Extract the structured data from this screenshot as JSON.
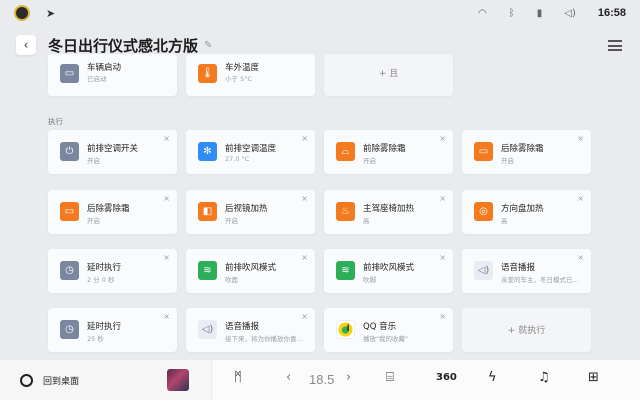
{
  "status_bar": {
    "time": "16:58",
    "icons": [
      "app-logo-icon",
      "navigation-arrow-icon",
      "wifi-icon",
      "bluetooth-icon",
      "signal-icon",
      "volume-icon"
    ]
  },
  "header": {
    "back_icon": "back-icon",
    "title": "冬日出行仪式感北方版",
    "edit_icon": "edit-icon",
    "filter_icon": "filter-icon"
  },
  "conditions": [
    {
      "title": "车辆启动",
      "subtitle": "已启动",
      "icon": "car-icon",
      "color": "#7b86a0"
    },
    {
      "title": "车外温度",
      "subtitle": "小于 5°C",
      "icon": "thermometer-icon",
      "color": "#f47a1f"
    }
  ],
  "condition_add": {
    "label": "+ 且"
  },
  "section_label": "执行",
  "actions": [
    {
      "title": "前排空调开关",
      "subtitle": "开启",
      "icon": "power-icon",
      "color": "#7b86a0"
    },
    {
      "title": "前排空调温度",
      "subtitle": "27.0 °C",
      "icon": "ac-temperature-icon",
      "color": "#2f8df4"
    },
    {
      "title": "前除雾除霜",
      "subtitle": "开启",
      "icon": "front-defrost-icon",
      "color": "#f47a1f"
    },
    {
      "title": "后除雾除霜",
      "subtitle": "开启",
      "icon": "rear-defrost-icon",
      "color": "#f47a1f"
    },
    {
      "title": "后除雾除霜",
      "subtitle": "开启",
      "icon": "rear-defrost-icon",
      "color": "#f47a1f"
    },
    {
      "title": "后视镜加热",
      "subtitle": "开启",
      "icon": "mirror-heat-icon",
      "color": "#f47a1f"
    },
    {
      "title": "主驾座椅加热",
      "subtitle": "高",
      "icon": "seat-heat-icon",
      "color": "#f47a1f"
    },
    {
      "title": "方向盘加热",
      "subtitle": "高",
      "icon": "steering-heat-icon",
      "color": "#f47a1f"
    },
    {
      "title": "延时执行",
      "subtitle": "2 分 0 秒",
      "icon": "delay-icon",
      "color": "#7b86a0"
    },
    {
      "title": "前排吹风模式",
      "subtitle": "吹面",
      "icon": "airflow-icon",
      "color": "#2fae5a"
    },
    {
      "title": "前排吹风模式",
      "subtitle": "吹脚",
      "icon": "airflow-icon",
      "color": "#2fae5a"
    },
    {
      "title": "语音播报",
      "subtitle": "亲爱的车主，冬日模式已…",
      "icon": "voice-broadcast-icon",
      "color": "#e9edf3"
    },
    {
      "title": "延时执行",
      "subtitle": "25 秒",
      "icon": "delay-icon",
      "color": "#7b86a0"
    },
    {
      "title": "语音播报",
      "subtitle": "接下来，将为你播放你喜…",
      "icon": "voice-broadcast-icon",
      "color": "#e9edf3"
    },
    {
      "title": "QQ 音乐",
      "subtitle": "播放\"我的收藏\"",
      "icon": "qq-music-icon",
      "color": "#ffffff"
    }
  ],
  "action_add": {
    "label": "+ 就执行"
  },
  "dock": {
    "home_label": "回到桌面",
    "temperature": "18.5",
    "icons": [
      "album-art",
      "fan-icon",
      "temp-down-icon",
      "temp-up-icon",
      "defrost-icon",
      "360-camera-icon",
      "charge-icon",
      "music-icon",
      "apps-grid-icon"
    ]
  }
}
